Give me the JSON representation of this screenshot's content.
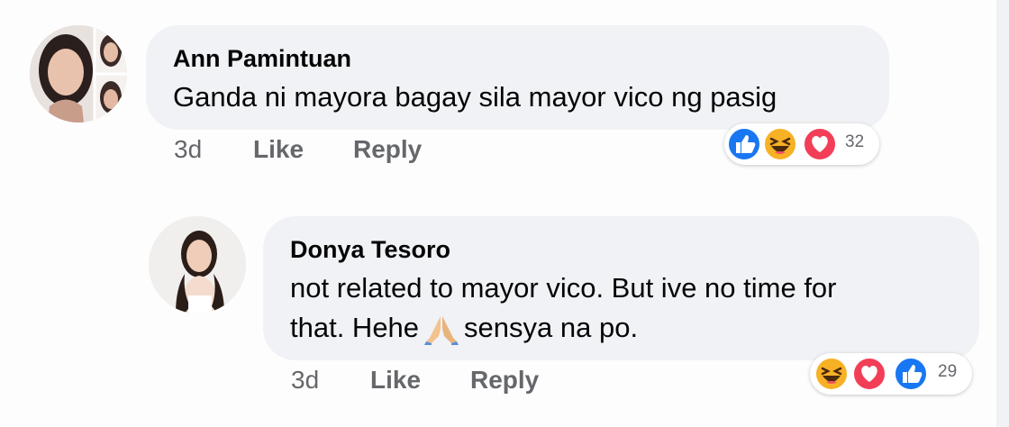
{
  "comments": [
    {
      "author": "Ann Pamintuan",
      "text": "Ganda ni mayora bagay sila mayor vico ng pasig",
      "time": "3d",
      "like_label": "Like",
      "reply_label": "Reply",
      "reactions": [
        "like-icon",
        "haha-icon",
        "love-icon"
      ],
      "reaction_count": "32"
    },
    {
      "author": "Donya Tesoro",
      "text_line1": "not related to mayor vico. But ive no time for",
      "text_line2_before": "that. Hehe",
      "text_line2_after": "sensya na po.",
      "emoji": "praying-hands-icon",
      "time": "3d",
      "like_label": "Like",
      "reply_label": "Reply",
      "reactions": [
        "haha-icon",
        "love-icon",
        "like-icon"
      ],
      "reaction_count": "29"
    }
  ],
  "colors": {
    "bubble": "#f0f2f5",
    "secondary_text": "#65676b",
    "primary_text": "#050505",
    "like_blue": "#1877f2",
    "love_red": "#f33e58",
    "haha_yellow": "#f7b125"
  }
}
